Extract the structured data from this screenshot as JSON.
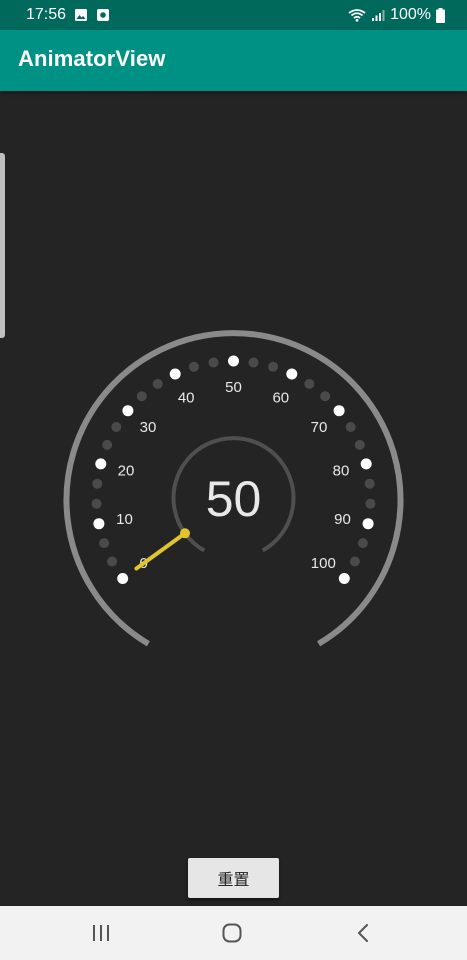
{
  "status_bar": {
    "time": "17:56",
    "battery": "100%",
    "icons": [
      "image-icon",
      "notification-icon",
      "wifi-icon",
      "signal-icon",
      "battery-icon"
    ]
  },
  "app_bar": {
    "title": "AnimatorView"
  },
  "gauge": {
    "value": "50",
    "needle_value": 0,
    "min": 0,
    "max": 100,
    "tick_labels": [
      "0",
      "10",
      "20",
      "30",
      "40",
      "50",
      "60",
      "70",
      "80",
      "90",
      "100"
    ],
    "colors": {
      "background": "#242424",
      "arc": "#8a8a8a",
      "major_dot": "#ffffff",
      "minor_dot": "#4a4a4a",
      "needle": "#e0c52b",
      "text": "#e8e8e8"
    }
  },
  "reset_button": {
    "label": "重置"
  },
  "nav_bar": {
    "icons": [
      "recent-apps-icon",
      "home-icon",
      "back-icon"
    ]
  }
}
